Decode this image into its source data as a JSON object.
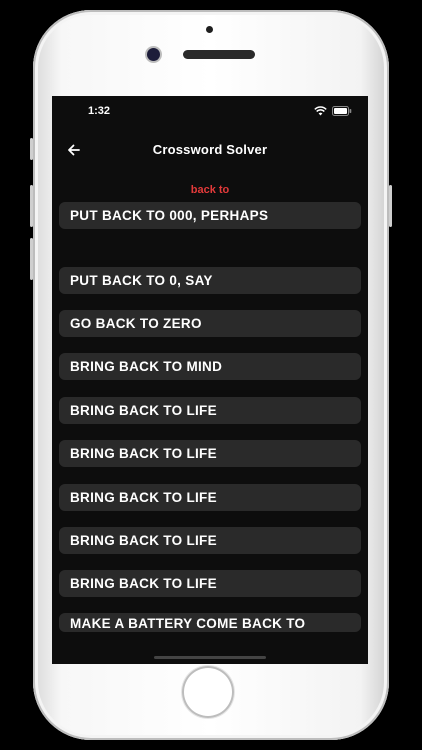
{
  "status_bar": {
    "time": "1:32"
  },
  "header": {
    "title": "Crossword Solver"
  },
  "query": {
    "text": "back to"
  },
  "results": [
    "PUT BACK TO 000, PERHAPS",
    "PUT BACK TO 0, SAY",
    "GO BACK TO ZERO",
    "BRING BACK TO MIND",
    "BRING BACK TO LIFE",
    "BRING BACK TO LIFE",
    "BRING BACK TO LIFE",
    "BRING BACK TO LIFE",
    "BRING BACK TO LIFE",
    "MAKE A BATTERY COME BACK TO"
  ],
  "colors": {
    "accent_red": "#e23a3a",
    "item_bg": "#2a2a2a",
    "screen_bg": "#0d0d0d"
  },
  "icons": {
    "back": "arrow-left-icon",
    "wifi": "wifi-icon",
    "battery": "battery-icon"
  }
}
